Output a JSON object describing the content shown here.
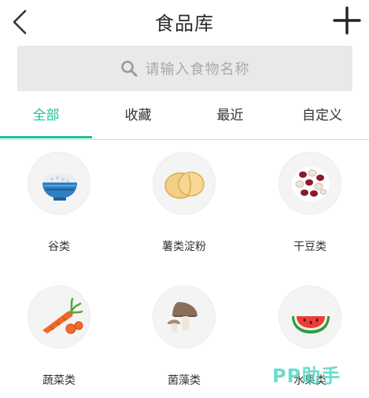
{
  "header": {
    "title": "食品库",
    "back_icon": "chevron-left-icon",
    "add_icon": "plus-icon"
  },
  "search": {
    "placeholder": "请输入食物名称",
    "icon": "search-icon"
  },
  "tabs": [
    {
      "label": "全部",
      "active": true
    },
    {
      "label": "收藏",
      "active": false
    },
    {
      "label": "最近",
      "active": false
    },
    {
      "label": "自定义",
      "active": false
    }
  ],
  "categories": [
    {
      "label": "谷类",
      "icon": "rice-bowl-icon"
    },
    {
      "label": "薯类淀粉",
      "icon": "potato-slices-icon"
    },
    {
      "label": "干豆类",
      "icon": "beans-icon"
    },
    {
      "label": "蔬菜类",
      "icon": "carrot-icon"
    },
    {
      "label": "菌藻类",
      "icon": "mushroom-icon"
    },
    {
      "label": "水果类",
      "icon": "watermelon-icon"
    }
  ],
  "watermark": "PP助手",
  "colors": {
    "accent": "#1fbf9a",
    "search_bg": "#e9e9e9",
    "divider": "#d9d9d9"
  }
}
